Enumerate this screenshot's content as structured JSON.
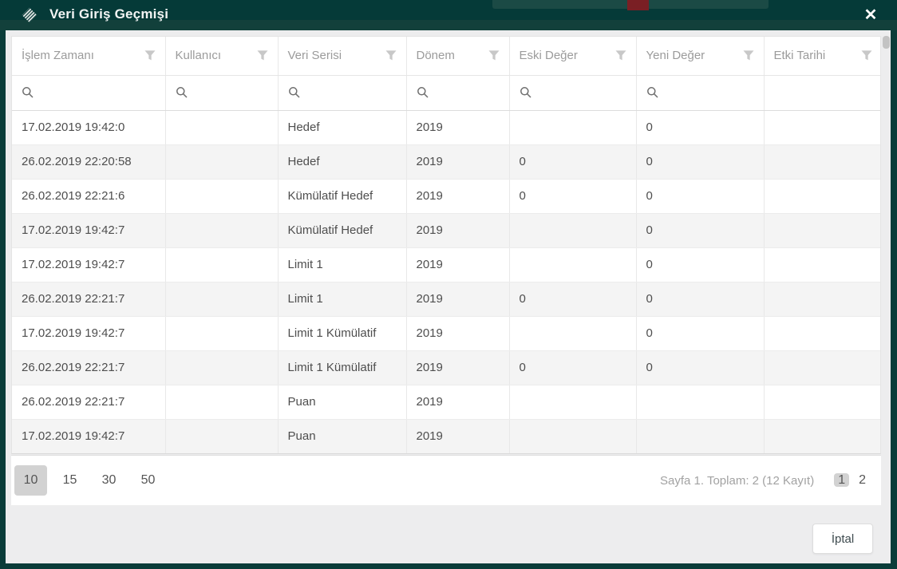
{
  "modal": {
    "title": "Veri Giriş Geçmişi",
    "title_icon": "hatched-diamond-icon",
    "close_glyph": "✕"
  },
  "table": {
    "columns": [
      {
        "key": "islem-zamani",
        "label": "İşlem Zamanı",
        "width": 192,
        "has_filter_icon": true,
        "has_search": true
      },
      {
        "key": "kullanici",
        "label": "Kullanıcı",
        "width": 141,
        "has_filter_icon": true,
        "has_search": true
      },
      {
        "key": "veri-serisi",
        "label": "Veri Serisi",
        "width": 161,
        "has_filter_icon": true,
        "has_search": true
      },
      {
        "key": "donem",
        "label": "Dönem",
        "width": 129,
        "has_filter_icon": true,
        "has_search": true
      },
      {
        "key": "eski-deger",
        "label": "Eski Değer",
        "width": 159,
        "has_filter_icon": true,
        "has_search": true
      },
      {
        "key": "yeni-deger",
        "label": "Yeni Değer",
        "width": 160,
        "has_filter_icon": true,
        "has_search": true
      },
      {
        "key": "etki-tarihi",
        "label": "Etki Tarihi",
        "width": 148,
        "has_filter_icon": true,
        "has_search": false
      }
    ],
    "rows": [
      [
        "17.02.2019 19:42:0",
        "",
        "Hedef",
        "2019",
        "",
        "0",
        ""
      ],
      [
        "26.02.2019 22:20:58",
        "",
        "Hedef",
        "2019",
        "0",
        "0",
        ""
      ],
      [
        "26.02.2019 22:21:6",
        "",
        "Kümülatif Hedef",
        "2019",
        "0",
        "0",
        ""
      ],
      [
        "17.02.2019 19:42:7",
        "",
        "Kümülatif Hedef",
        "2019",
        "",
        "0",
        ""
      ],
      [
        "17.02.2019 19:42:7",
        "",
        "Limit 1",
        "2019",
        "",
        "0",
        ""
      ],
      [
        "26.02.2019 22:21:7",
        "",
        "Limit 1",
        "2019",
        "0",
        "0",
        ""
      ],
      [
        "17.02.2019 19:42:7",
        "",
        "Limit 1 Kümülatif",
        "2019",
        "",
        "0",
        ""
      ],
      [
        "26.02.2019 22:21:7",
        "",
        "Limit 1 Kümülatif",
        "2019",
        "0",
        "0",
        ""
      ],
      [
        "26.02.2019 22:21:7",
        "",
        "Puan",
        "2019",
        "",
        "",
        ""
      ],
      [
        "17.02.2019 19:42:7",
        "",
        "Puan",
        "2019",
        "",
        "",
        ""
      ]
    ]
  },
  "pagination": {
    "page_sizes": [
      "10",
      "15",
      "30",
      "50"
    ],
    "selected_size": "10",
    "summary": "Sayfa 1. Toplam: 2 (12 Kayıt)",
    "pages": [
      "1",
      "2"
    ],
    "current_page": "1"
  },
  "footer": {
    "cancel_label": "İptal"
  },
  "colors": {
    "titlebar": "#053a38",
    "titlebar_band": "#12403b",
    "background_badge": "#7a1f24",
    "body_background": "#ededee",
    "row_alternate": "#f4f4f4",
    "selected_background": "#d2d2d2",
    "header_text": "#9b9b9b",
    "cell_text": "#4e4e4e"
  }
}
